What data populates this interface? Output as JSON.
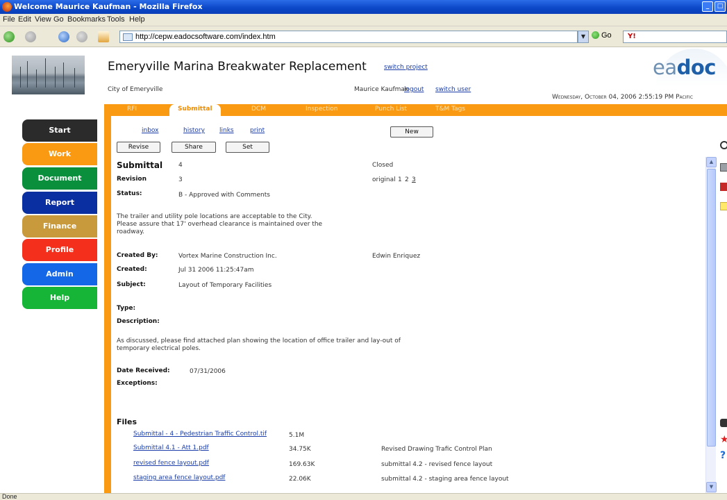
{
  "window": {
    "title": "Welcome Maurice Kaufman - Mozilla Firefox"
  },
  "menu": [
    "File",
    "Edit",
    "View",
    "Go",
    "Bookmarks",
    "Tools",
    "Help"
  ],
  "browser": {
    "url": "http://cepw.eadocsoftware.com/index.htm",
    "go_label": "Go"
  },
  "header": {
    "project_title": "Emeryville Marina Breakwater Replacement",
    "switch_project": "switch project",
    "brand_prefix": "ea",
    "brand_suffix": "doc",
    "city": "City of Emeryville",
    "user": "Maurice Kaufman",
    "logout": "logout",
    "switch_user": "switch user",
    "datetime": "Wednesday, October 04, 2006 2:55:19 PM Pacific"
  },
  "tabs": [
    "RFI",
    "Submittal",
    "DCM",
    "Inspection",
    "Punch List",
    "T&M Tags"
  ],
  "active_tab": "Submittal",
  "nav": [
    {
      "label": "Start",
      "color": "#2b2b2b"
    },
    {
      "label": "Work",
      "color": "#f99a12"
    },
    {
      "label": "Document",
      "color": "#0a8f3c"
    },
    {
      "label": "Report",
      "color": "#0a2fa0"
    },
    {
      "label": "Finance",
      "color": "#c99a3c"
    },
    {
      "label": "Profile",
      "color": "#f4301c"
    },
    {
      "label": "Admin",
      "color": "#1467e6"
    },
    {
      "label": "Help",
      "color": "#16b538"
    }
  ],
  "subnav": {
    "inbox": "inbox",
    "history": "history",
    "links": "links",
    "print": "print",
    "new": "New"
  },
  "actions": {
    "revise": "Revise",
    "share": "Share",
    "set": "Set"
  },
  "submittal": {
    "label": "Submittal",
    "number": "4",
    "state": "Closed",
    "revision_label": "Revision",
    "revision": "3",
    "revisions_prefix": "original",
    "revisions": [
      "1",
      "2",
      "3"
    ],
    "status_label": "Status:",
    "status": "B - Approved with Comments",
    "comment_line1": "The trailer and utility pole locations are acceptable to the City.",
    "comment_line2": "Please assure that 17' overhead clearance is maintained over the",
    "comment_line3": "roadway.",
    "created_by_label": "Created By:",
    "created_by": "Vortex Marine Construction Inc.",
    "created_by_person": "Edwin Enriquez",
    "created_label": "Created:",
    "created": "Jul 31 2006 11:25:47am",
    "subject_label": "Subject:",
    "subject": "Layout of Temporary Facilities",
    "type_label": "Type:",
    "description_label": "Description:",
    "description_line1": "As discussed, please find attached plan showing the location of office trailer and lay-out of",
    "description_line2": "temporary electrical poles.",
    "date_received_label": "Date Received:",
    "date_received": "07/31/2006",
    "exceptions_label": "Exceptions:"
  },
  "files": {
    "heading": "Files",
    "rows": [
      {
        "name": "Submittal - 4 - Pedestrian Traffic Control.tif",
        "size": "5.1M",
        "note": ""
      },
      {
        "name": "Submittal 4.1 - Att 1.pdf",
        "size": "34.75K",
        "note": "Revised Drawing Trafic Control Plan"
      },
      {
        "name": "revised fence layout.pdf",
        "size": "169.63K",
        "note": "submittal 4.2 - revised fence layout"
      },
      {
        "name": "staging area fence layout.pdf",
        "size": "22.06K",
        "note": "submittal 4.2 - staging area fence layout"
      }
    ]
  },
  "status_bar": "Done"
}
